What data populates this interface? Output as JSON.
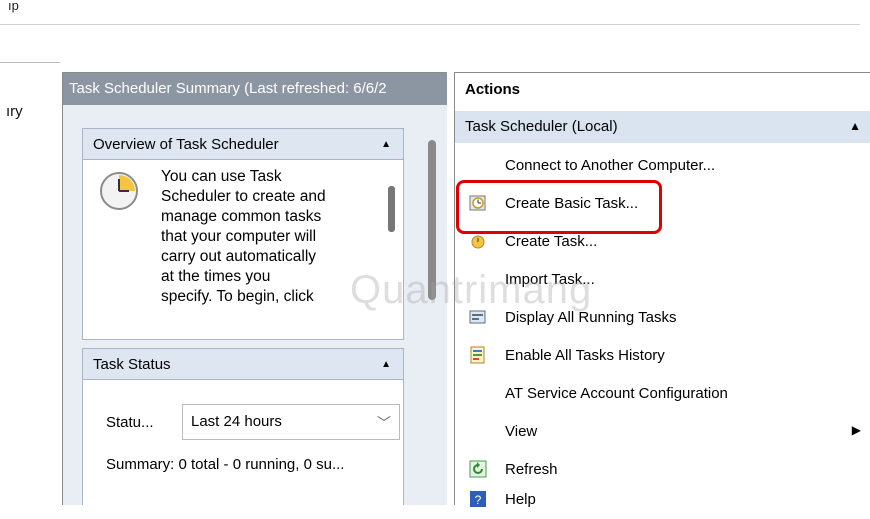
{
  "menubar": {
    "cut_text": "ıp"
  },
  "tree": {
    "fragment": "ıry"
  },
  "summary": {
    "header": "Task Scheduler Summary (Last refreshed: 6/6/2",
    "overview": {
      "title": "Overview of Task Scheduler",
      "lines": [
        "You can use Task",
        "Scheduler to create and",
        "manage common tasks",
        "that your computer will",
        "carry out automatically",
        "at the times you",
        "specify. To begin, click"
      ]
    },
    "status": {
      "title": "Task Status",
      "status_label": "Statu...",
      "dropdown_value": "Last 24 hours",
      "summary_line": "Summary: 0 total - 0 running, 0 su..."
    }
  },
  "actions": {
    "title": "Actions",
    "group": "Task Scheduler (Local)",
    "items": [
      {
        "label": "Connect to Another Computer...",
        "icon": "none"
      },
      {
        "label": "Create Basic Task...",
        "icon": "basic-task-icon"
      },
      {
        "label": "Create Task...",
        "icon": "create-task-icon"
      },
      {
        "label": "Import Task...",
        "icon": "none"
      },
      {
        "label": "Display All Running Tasks",
        "icon": "running-tasks-icon"
      },
      {
        "label": "Enable All Tasks History",
        "icon": "history-icon"
      },
      {
        "label": "AT Service Account Configuration",
        "icon": "none"
      },
      {
        "label": "View",
        "icon": "none",
        "submenu": true
      },
      {
        "label": "Refresh",
        "icon": "refresh-icon"
      },
      {
        "label": "Help",
        "icon": "help-icon"
      }
    ]
  },
  "watermark": "Quantrimang",
  "colors": {
    "highlight": "#e00000",
    "header": "#8c96a3",
    "group": "#d9e4f0"
  }
}
